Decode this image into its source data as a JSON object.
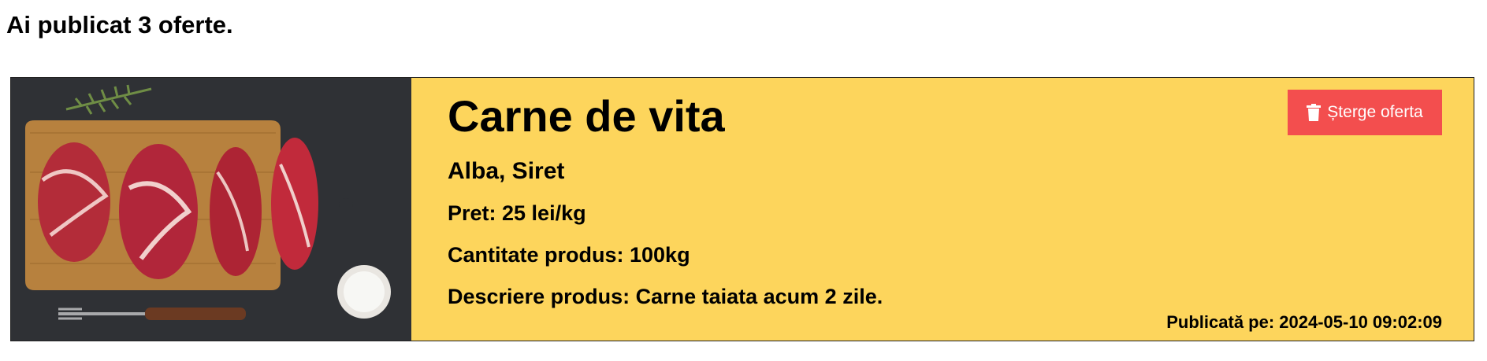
{
  "summary": "Ai publicat 3 oferte.",
  "offer": {
    "title": "Carne de vita",
    "location": "Alba, Siret",
    "price": "Pret: 25 lei/kg",
    "quantity": "Cantitate produs: 100kg",
    "description": "Descriere produs: Carne taiata acum 2 zile.",
    "delete_label": "Șterge oferta",
    "published": "Publicată pe: 2024-05-10 09:02:09",
    "image_icon": "meat-photo"
  },
  "colors": {
    "card_background": "#fdd55c",
    "delete_button": "#f34e4e",
    "text": "#000000"
  }
}
